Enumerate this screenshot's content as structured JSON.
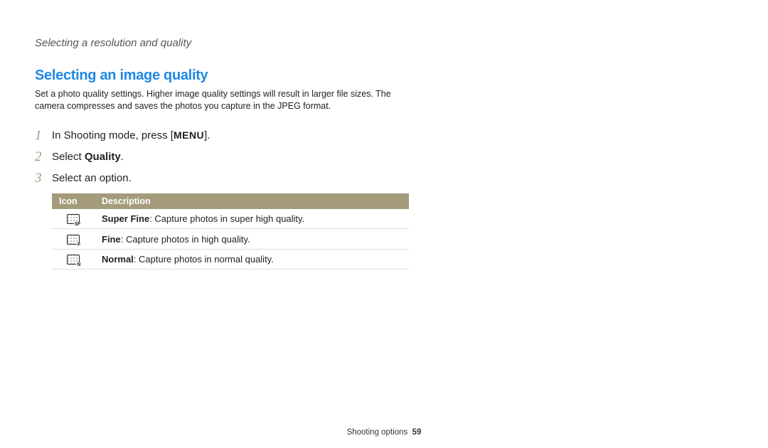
{
  "breadcrumb": "Selecting a resolution and quality",
  "section": {
    "title": "Selecting an image quality",
    "description": "Set a photo quality settings. Higher image quality settings will result in larger file sizes. The camera compresses and saves the photos you capture in the JPEG format."
  },
  "steps": [
    {
      "num": "1",
      "pre": "In Shooting mode, press [",
      "label": "MENU",
      "post": "]."
    },
    {
      "num": "2",
      "pre": "Select ",
      "bold": "Quality",
      "post": "."
    },
    {
      "num": "3",
      "pre": "Select an option.",
      "post": ""
    }
  ],
  "table": {
    "headers": {
      "icon": "Icon",
      "desc": "Description"
    },
    "rows": [
      {
        "sub": "SF",
        "bold": "Super Fine",
        "rest": ": Capture photos in super high quality."
      },
      {
        "sub": "F",
        "bold": "Fine",
        "rest": ": Capture photos in high quality."
      },
      {
        "sub": "N",
        "bold": "Normal",
        "rest": ": Capture photos in normal quality."
      }
    ]
  },
  "footer": {
    "section": "Shooting options",
    "page": "59"
  }
}
